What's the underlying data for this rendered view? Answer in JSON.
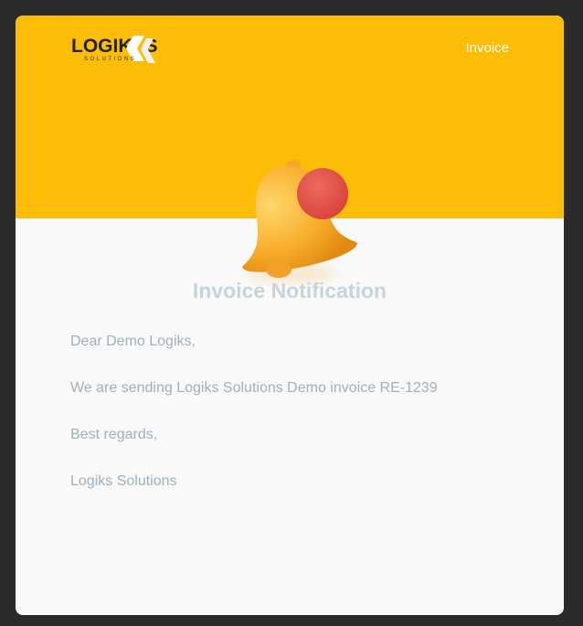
{
  "brand": {
    "logo_main": "LOGIK",
    "logo_end": "S",
    "logo_sub": "SOLUTIONS"
  },
  "header": {
    "invoice_link": "Invoice"
  },
  "colors": {
    "header_bg": "#fbbd05",
    "bell_dot": "#e5524a",
    "title": "#c9d3da",
    "text": "#9fb0bc"
  },
  "notification": {
    "icon": "bell-icon",
    "title": "Invoice Notification"
  },
  "message": {
    "greeting": "Dear Demo Logiks,",
    "body": "We are sending Logiks Solutions Demo invoice RE-1239",
    "closing": "Best regards,",
    "signature": "Logiks Solutions"
  }
}
